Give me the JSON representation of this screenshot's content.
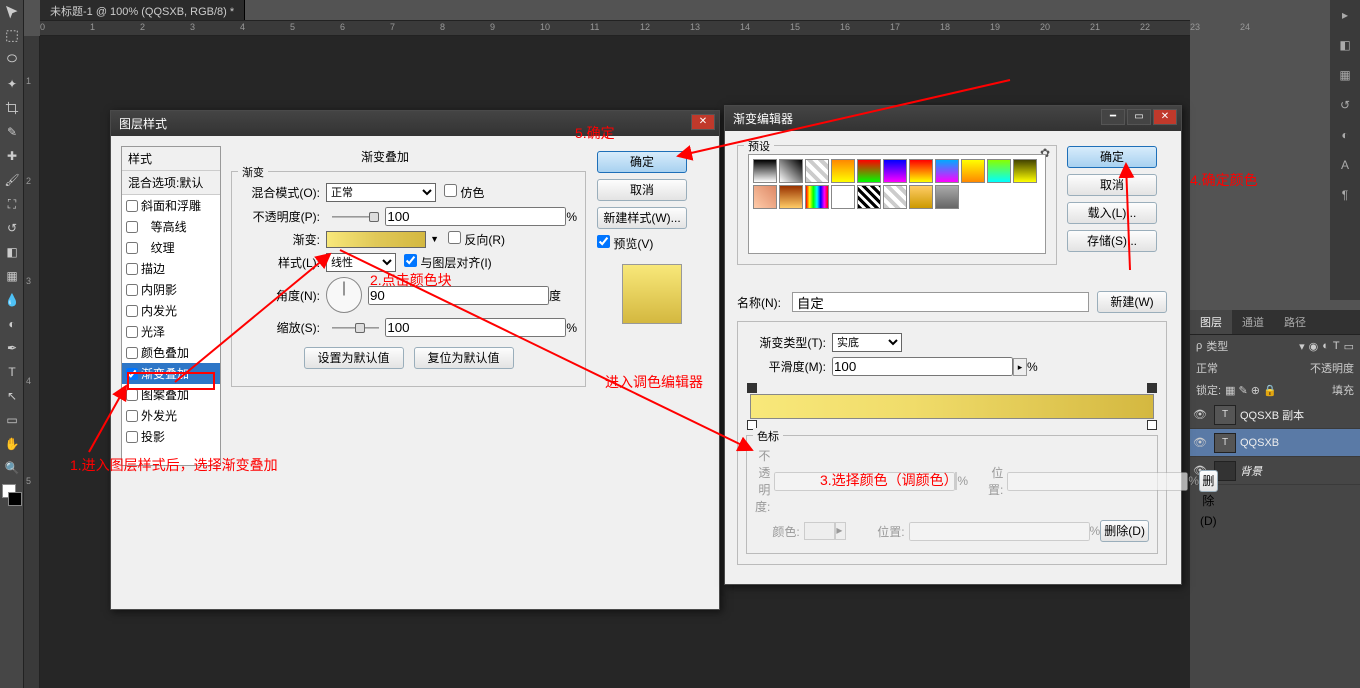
{
  "doc_tab": "未标题-1 @ 100% (QQSXB, RGB/8) *",
  "ruler_marks": [
    "0",
    "1",
    "2",
    "3",
    "4",
    "5",
    "6",
    "7",
    "8",
    "9",
    "10",
    "11",
    "12",
    "13",
    "14",
    "15",
    "16",
    "17",
    "18",
    "19",
    "20",
    "21",
    "22",
    "23",
    "24"
  ],
  "ruler_v": [
    "1",
    "2",
    "3",
    "4",
    "5"
  ],
  "layer_style_dialog": {
    "title": "图层样式",
    "styles_header": "样式",
    "blend_options": "混合选项:默认",
    "items": [
      "斜面和浮雕",
      "等高线",
      "纹理",
      "描边",
      "内阴影",
      "内发光",
      "光泽",
      "颜色叠加",
      "渐变叠加",
      "图案叠加",
      "外发光",
      "投影"
    ],
    "selected_index": 8,
    "section_title": "渐变叠加",
    "sub_title": "渐变",
    "blend_mode_label": "混合模式(O):",
    "blend_mode_val": "正常",
    "dither": "仿色",
    "opacity_label": "不透明度(P):",
    "opacity_val": "100",
    "pct": "%",
    "gradient_label": "渐变:",
    "reverse": "反向(R)",
    "style_label": "样式(L):",
    "style_val": "线性",
    "align": "与图层对齐(I)",
    "angle_label": "角度(N):",
    "angle_val": "90",
    "deg": "度",
    "scale_label": "缩放(S):",
    "scale_val": "100",
    "set_default": "设置为默认值",
    "reset_default": "复位为默认值",
    "ok": "确定",
    "cancel": "取消",
    "new_style": "新建样式(W)...",
    "preview": "预览(V)"
  },
  "gradient_editor": {
    "title": "渐变编辑器",
    "presets": "预设",
    "name_label": "名称(N):",
    "name_val": "自定",
    "new_btn": "新建(W)",
    "type_label": "渐变类型(T):",
    "type_val": "实底",
    "smooth_label": "平滑度(M):",
    "smooth_val": "100",
    "pct": "%",
    "stops_title": "色标",
    "stop_opacity": "不透明度:",
    "stop_pos": "位置:",
    "delete": "删除(D)",
    "stop_color": "颜色:",
    "ok": "确定",
    "cancel": "取消",
    "load": "载入(L)...",
    "save": "存储(S)..."
  },
  "layers_panel": {
    "tabs": [
      "图层",
      "通道",
      "路径"
    ],
    "kind": "类型",
    "blend": "正常",
    "opacity_label": "不透明度",
    "lock": "锁定:",
    "fill": "填充",
    "layers": [
      {
        "name": "QQSXB 副本",
        "type": "T",
        "active": false
      },
      {
        "name": "QQSXB",
        "type": "T",
        "active": true
      },
      {
        "name": "背景",
        "type": "bg",
        "active": false
      }
    ]
  },
  "annotations": {
    "a1": "1.进入图层样式后，选择渐变叠加",
    "a2": "2.点击颜色块",
    "a3": "3.选择颜色（调颜色）",
    "a3b": "进入调色编辑器",
    "a4": "4.确定颜色",
    "a5": "5.确定"
  },
  "preset_gradients": [
    "linear-gradient(#000,#fff)",
    "linear-gradient(45deg,#fff,#000)",
    "repeating-linear-gradient(45deg,#ccc 0 4px,#fff 4px 8px)",
    "linear-gradient(#f80,#ff0)",
    "linear-gradient(#f00,#0f0)",
    "linear-gradient(#00f,#f0f)",
    "linear-gradient(#f00,#ff0)",
    "linear-gradient(#0af,#f0f)",
    "linear-gradient(#ff0,#f80)",
    "linear-gradient(#8f0,#0ff)",
    "linear-gradient(#440,#ff0)",
    "linear-gradient(45deg,#fca,#d86)",
    "linear-gradient(#930,#fc6)",
    "linear-gradient(to right,#f00,#ff0,#0f0,#0ff,#00f,#f0f,#f00)",
    "linear-gradient(#fff,#fff)",
    "repeating-linear-gradient(45deg,#000 0 3px,#fff 3px 6px)",
    "repeating-linear-gradient(45deg,#ccc 0 4px,#fff 4px 8px)",
    "linear-gradient(#fc6,#c90)",
    "linear-gradient(#aaa,#666)"
  ]
}
